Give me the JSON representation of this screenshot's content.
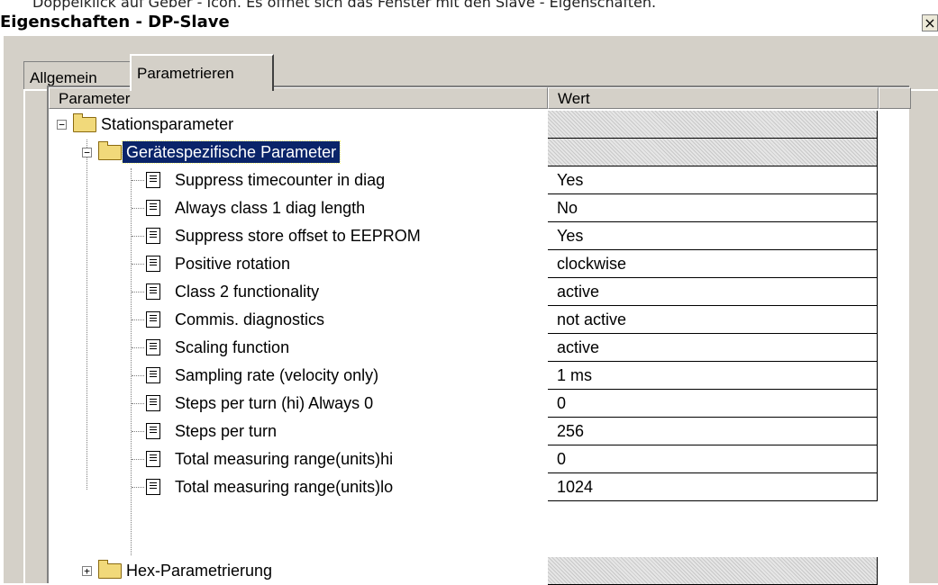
{
  "caption": "Doppelklick auf Geber - Icon. Es öffnet sich das Fenster mit den Slave - Eigenschaften.",
  "window": {
    "title": "Eigenschaften - DP-Slave",
    "close_glyph": "×"
  },
  "tabs": [
    {
      "label": "Allgemein",
      "active": false
    },
    {
      "label": "Parametrieren",
      "active": true
    }
  ],
  "grid": {
    "headers": {
      "parameter": "Parameter",
      "value": "Wert"
    },
    "tree": {
      "station": {
        "label": "Stationsparameter",
        "expander": "−",
        "icon": "folder-open-icon"
      },
      "device": {
        "label": "Gerätespezifische Parameter",
        "expander": "−",
        "icon": "folder-open-icon",
        "selected": true
      },
      "params": [
        {
          "label": "Suppress timecounter in diag",
          "value": "Yes"
        },
        {
          "label": "Always class 1 diag length",
          "value": "No"
        },
        {
          "label": "Suppress store offset to EEPROM",
          "value": "Yes"
        },
        {
          "label": "Positive rotation",
          "value": "clockwise"
        },
        {
          "label": "Class 2 functionality",
          "value": "active"
        },
        {
          "label": "Commis. diagnostics",
          "value": "not active"
        },
        {
          "label": "Scaling function",
          "value": "active"
        },
        {
          "label": "Sampling rate (velocity only)",
          "value": "1 ms"
        },
        {
          "label": "Steps per turn (hi) Always 0",
          "value": "0"
        },
        {
          "label": "Steps per turn",
          "value": "256"
        },
        {
          "label": "Total measuring range(units)hi",
          "value": "0"
        },
        {
          "label": "Total measuring range(units)lo",
          "value": "1024"
        }
      ],
      "hex": {
        "label": "Hex-Parametrierung",
        "expander": "+",
        "icon": "folder-icon"
      }
    }
  },
  "colors": {
    "dialog_bg": "#d4d0c8",
    "selection_bg": "#0a246a"
  }
}
